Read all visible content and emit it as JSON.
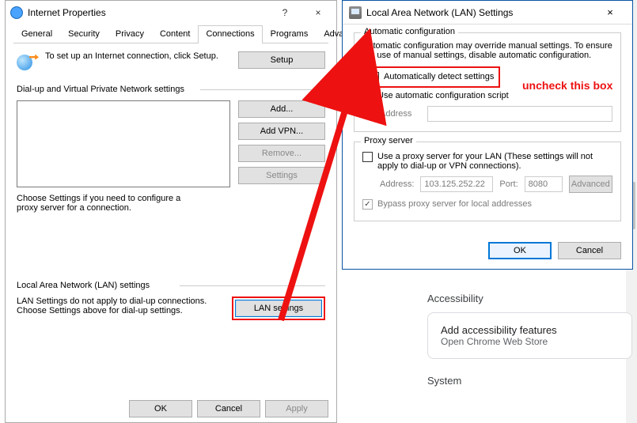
{
  "ip": {
    "title": "Internet Properties",
    "tabs": [
      "General",
      "Security",
      "Privacy",
      "Content",
      "Connections",
      "Programs",
      "Advanced"
    ],
    "active_tab": 4,
    "setup_text": "To set up an Internet connection, click Setup.",
    "setup_btn": "Setup",
    "vpn_label": "Dial-up and Virtual Private Network settings",
    "btn_add": "Add...",
    "btn_addvpn": "Add VPN...",
    "btn_remove": "Remove...",
    "btn_settings": "Settings",
    "vpn_note": "Choose Settings if you need to configure a proxy server for a connection.",
    "lan_label": "Local Area Network (LAN) settings",
    "lan_note": "LAN Settings do not apply to dial-up connections.  Choose Settings above for dial-up settings.",
    "btn_lan": "LAN settings",
    "btn_ok": "OK",
    "btn_cancel": "Cancel",
    "btn_apply": "Apply"
  },
  "lan": {
    "title": "Local Area Network (LAN) Settings",
    "auto_group": "Automatic configuration",
    "auto_text": "Automatic configuration may override manual settings.  To ensure the use of manual settings, disable automatic configuration.",
    "auto_detect": "Automatically detect settings",
    "auto_script": "Use automatic configuration script",
    "addr_label": "Address",
    "proxy_group": "Proxy server",
    "proxy_use": "Use a proxy server for your LAN (These settings will not apply to dial-up or VPN connections).",
    "proxy_addr_label": "Address:",
    "proxy_addr": "103.125.252.22",
    "proxy_port_label": "Port:",
    "proxy_port": "8080",
    "btn_advanced": "Advanced",
    "bypass": "Bypass proxy server for local addresses",
    "btn_ok": "OK",
    "btn_cancel": "Cancel"
  },
  "annot": "uncheck this box",
  "chrome": {
    "accessibility": "Accessibility",
    "add_feat": "Add accessibility features",
    "store": "Open Chrome Web Store",
    "system": "System"
  }
}
